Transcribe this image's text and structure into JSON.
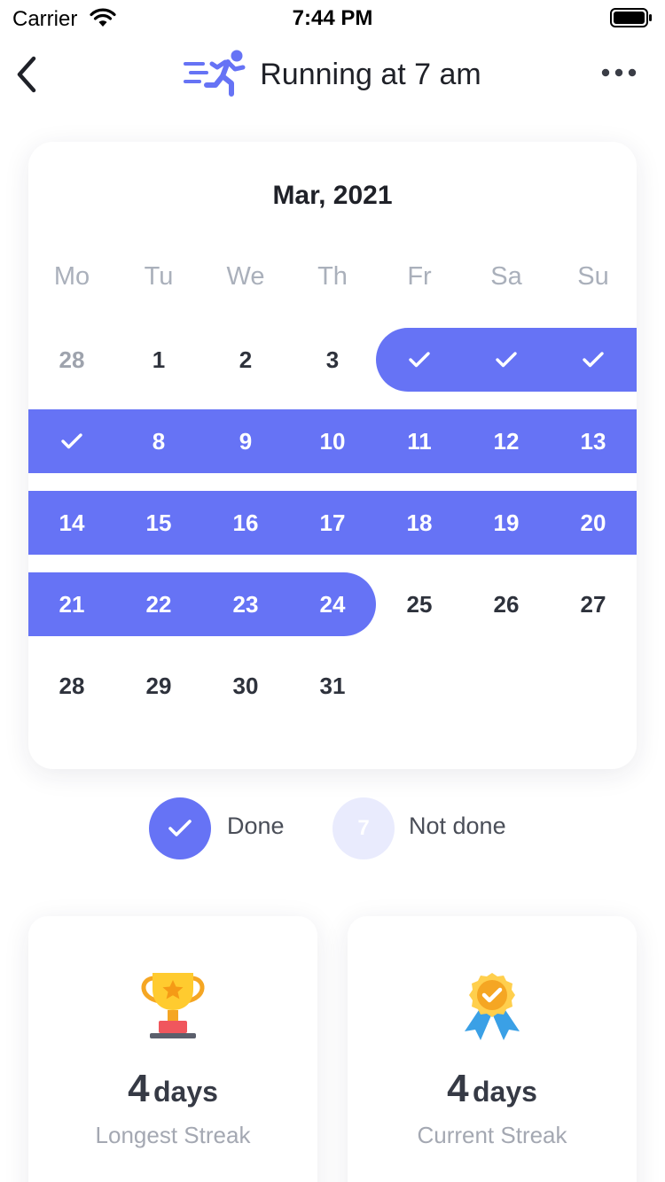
{
  "status_bar": {
    "carrier": "Carrier",
    "time": "7:44 PM"
  },
  "header": {
    "title": "Running at 7 am",
    "icon": "running-person-icon"
  },
  "colors": {
    "accent": "#6673f5",
    "not_done": "#e9ebfd"
  },
  "calendar": {
    "month": "Mar, 2021",
    "weekdays": [
      "Mo",
      "Tu",
      "We",
      "Th",
      "Fr",
      "Sa",
      "Su"
    ],
    "weeks": [
      [
        {
          "label": "28",
          "state": "muted"
        },
        {
          "label": "1",
          "state": "none"
        },
        {
          "label": "2",
          "state": "none"
        },
        {
          "label": "3",
          "state": "none"
        },
        {
          "label": "",
          "state": "done-check"
        },
        {
          "label": "",
          "state": "done-check"
        },
        {
          "label": "",
          "state": "done-check"
        }
      ],
      [
        {
          "label": "",
          "state": "done-check"
        },
        {
          "label": "8",
          "state": "done"
        },
        {
          "label": "9",
          "state": "done"
        },
        {
          "label": "10",
          "state": "done"
        },
        {
          "label": "11",
          "state": "done"
        },
        {
          "label": "12",
          "state": "done"
        },
        {
          "label": "13",
          "state": "done"
        }
      ],
      [
        {
          "label": "14",
          "state": "done"
        },
        {
          "label": "15",
          "state": "done"
        },
        {
          "label": "16",
          "state": "done"
        },
        {
          "label": "17",
          "state": "done"
        },
        {
          "label": "18",
          "state": "done"
        },
        {
          "label": "19",
          "state": "done"
        },
        {
          "label": "20",
          "state": "done"
        }
      ],
      [
        {
          "label": "21",
          "state": "done"
        },
        {
          "label": "22",
          "state": "done"
        },
        {
          "label": "23",
          "state": "done"
        },
        {
          "label": "24",
          "state": "done"
        },
        {
          "label": "25",
          "state": "none"
        },
        {
          "label": "26",
          "state": "none"
        },
        {
          "label": "27",
          "state": "none"
        }
      ],
      [
        {
          "label": "28",
          "state": "none"
        },
        {
          "label": "29",
          "state": "none"
        },
        {
          "label": "30",
          "state": "none"
        },
        {
          "label": "31",
          "state": "none"
        }
      ]
    ]
  },
  "legend": {
    "done_label": "Done",
    "not_done_sample": "7",
    "not_done_label": "Not done"
  },
  "stats": {
    "longest": {
      "value": "4",
      "unit": "days",
      "label": "Longest Streak",
      "icon": "trophy-icon"
    },
    "current": {
      "value": "4",
      "unit": "days",
      "label": "Current Streak",
      "icon": "medal-icon"
    }
  }
}
